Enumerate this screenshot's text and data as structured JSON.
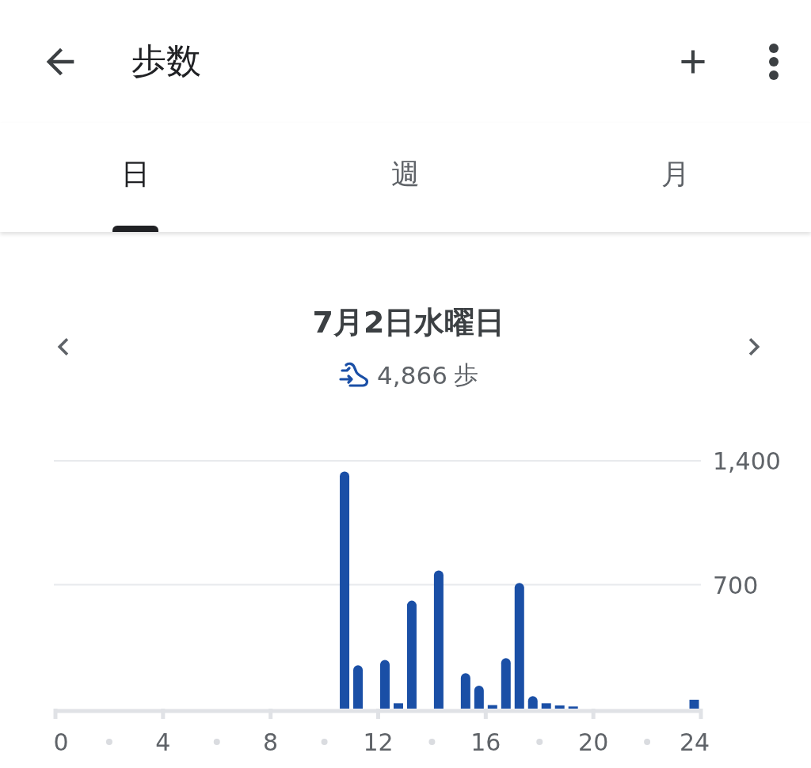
{
  "app_bar": {
    "title": "歩数"
  },
  "tabs": [
    {
      "label": "日",
      "selected": true
    },
    {
      "label": "週",
      "selected": false
    },
    {
      "label": "月",
      "selected": false
    }
  ],
  "day_summary": {
    "date": "7月2日水曜日",
    "steps": "4,866",
    "unit": "歩"
  },
  "chart": {
    "chart_data": {
      "type": "bar",
      "x": [
        0.25,
        0.75,
        1.25,
        1.75,
        2.25,
        2.75,
        3.25,
        3.75,
        4.25,
        4.75,
        5.25,
        5.75,
        6.25,
        6.75,
        7.25,
        7.75,
        8.25,
        8.75,
        9.25,
        9.75,
        10.25,
        10.75,
        11.25,
        11.75,
        12.25,
        12.75,
        13.25,
        13.75,
        14.25,
        14.75,
        15.25,
        15.75,
        16.25,
        16.75,
        17.25,
        17.75,
        18.25,
        18.75,
        19.25,
        19.75,
        20.25,
        20.75,
        21.25,
        21.75,
        22.25,
        22.75,
        23.25,
        23.75
      ],
      "values": [
        0,
        0,
        0,
        0,
        0,
        0,
        0,
        0,
        0,
        0,
        0,
        0,
        0,
        0,
        0,
        0,
        0,
        0,
        0,
        0,
        0,
        1340,
        245,
        0,
        275,
        30,
        610,
        0,
        780,
        0,
        200,
        130,
        20,
        285,
        710,
        70,
        30,
        18,
        12,
        0,
        0,
        0,
        0,
        0,
        0,
        0,
        0,
        50
      ],
      "xlim": [
        0,
        24
      ],
      "ylim": [
        0,
        1400
      ],
      "xticks": [
        0,
        4,
        8,
        12,
        16,
        20,
        24
      ],
      "yticks": [
        {
          "value": 700,
          "label": "700"
        },
        {
          "value": 1400,
          "label": "1,400"
        }
      ]
    }
  }
}
